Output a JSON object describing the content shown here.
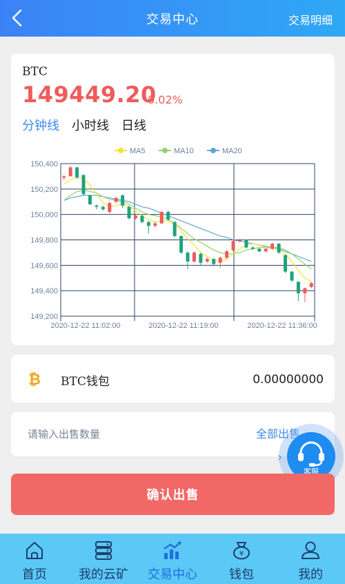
{
  "header": {
    "title": "交易中心",
    "right_link": "交易明细"
  },
  "coin": {
    "name": "BTC",
    "price": "149449.20",
    "change": "0.02%"
  },
  "period_tabs": [
    {
      "label": "分钟线",
      "active": true
    },
    {
      "label": "小时线",
      "active": false
    },
    {
      "label": "日线",
      "active": false
    }
  ],
  "chart_data": {
    "type": "candlestick",
    "legend": [
      "MA5",
      "MA10",
      "MA20"
    ],
    "legend_colors": [
      "#f3e433",
      "#97d16b",
      "#5ea8d0"
    ],
    "y_ticks": [
      "150,400",
      "150,200",
      "150,000",
      "149,800",
      "149,600",
      "149,400",
      "149,200"
    ],
    "ylim": [
      149200,
      150400
    ],
    "x_ticks": [
      "2020-12-22 11:02:00",
      "2020-12-22 11:19:00",
      "2020-12-22 11:36:00"
    ],
    "candles": [
      [
        150290,
        150300,
        150270,
        150310
      ],
      [
        150300,
        150370,
        150300,
        150380
      ],
      [
        150370,
        150290,
        150280,
        150375
      ],
      [
        150310,
        150160,
        150150,
        150315
      ],
      [
        150150,
        150080,
        150075,
        150155
      ],
      [
        150070,
        150060,
        150040,
        150080
      ],
      [
        150060,
        150040,
        150030,
        150070
      ],
      [
        150020,
        150090,
        150010,
        150100
      ],
      [
        150100,
        150130,
        150090,
        150140
      ],
      [
        150150,
        150070,
        150050,
        150160
      ],
      [
        150060,
        149970,
        149960,
        150070
      ],
      [
        149970,
        149990,
        149960,
        150000
      ],
      [
        149990,
        149940,
        149930,
        149995
      ],
      [
        149940,
        149910,
        149850,
        149950
      ],
      [
        149910,
        149930,
        149900,
        149945
      ],
      [
        149930,
        150020,
        149925,
        150030
      ],
      [
        150020,
        149960,
        149950,
        150030
      ],
      [
        149940,
        149830,
        149820,
        149950
      ],
      [
        149830,
        149700,
        149690,
        149835
      ],
      [
        149700,
        149630,
        149570,
        149710
      ],
      [
        149630,
        149700,
        149620,
        149710
      ],
      [
        149690,
        149620,
        149600,
        149700
      ],
      [
        149630,
        149650,
        149620,
        149660
      ],
      [
        149650,
        149610,
        149600,
        149655
      ],
      [
        149620,
        149660,
        149580,
        149670
      ],
      [
        149660,
        149710,
        149650,
        149720
      ],
      [
        149720,
        149790,
        149710,
        149800
      ],
      [
        149790,
        149800,
        149780,
        149810
      ],
      [
        149800,
        149740,
        149735,
        149805
      ],
      [
        149740,
        149730,
        149720,
        149750
      ],
      [
        149730,
        149710,
        149700,
        149735
      ],
      [
        149710,
        149730,
        149700,
        149740
      ],
      [
        149730,
        149770,
        149720,
        149780
      ],
      [
        149770,
        149700,
        149690,
        149775
      ],
      [
        149680,
        149550,
        149540,
        149685
      ],
      [
        149550,
        149480,
        149470,
        149555
      ],
      [
        149470,
        149380,
        149320,
        149475
      ],
      [
        149380,
        149420,
        149310,
        149425
      ],
      [
        149430,
        149460,
        149420,
        149470
      ]
    ],
    "ma5": [
      150240,
      150270,
      150300,
      150280,
      150230,
      150160,
      150090,
      150060,
      150070,
      150080,
      150060,
      150030,
      149990,
      149960,
      149940,
      149950,
      149950,
      149920,
      149870,
      149810,
      149760,
      149700,
      149670,
      149640,
      149630,
      149650,
      149690,
      149730,
      149760,
      149770,
      149760,
      149740,
      149730,
      149730,
      149690,
      149630,
      149560,
      149500,
      149470
    ],
    "ma10": [
      150110,
      150150,
      150180,
      150190,
      150180,
      150170,
      150140,
      150120,
      150110,
      150100,
      150080,
      150050,
      150020,
      150000,
      149990,
      149980,
      149960,
      149930,
      149890,
      149850,
      149810,
      149780,
      149750,
      149720,
      149700,
      149690,
      149690,
      149700,
      149720,
      149730,
      149740,
      149740,
      149740,
      149740,
      149720,
      149690,
      149650,
      149610,
      149570
    ],
    "ma20": [
      150110,
      150130,
      150140,
      150150,
      150150,
      150150,
      150140,
      150130,
      150120,
      150110,
      150100,
      150080,
      150060,
      150050,
      150030,
      150010,
      149990,
      149970,
      149950,
      149930,
      149910,
      149890,
      149870,
      149850,
      149830,
      149820,
      149800,
      149790,
      149780,
      149770,
      149760,
      149750,
      149740,
      149730,
      149710,
      149690,
      149670,
      149650,
      149630
    ]
  },
  "wallet": {
    "label": "BTC钱包",
    "balance": "0.00000000",
    "icon": "bitcoin-icon"
  },
  "sell": {
    "placeholder": "请输入出售数量",
    "all_label": "全部出售"
  },
  "service": {
    "label": "客服"
  },
  "confirm_label": "确认出售",
  "tabs": [
    {
      "label": "首页",
      "icon": "home-icon",
      "active": false
    },
    {
      "label": "我的云矿",
      "icon": "server-icon",
      "active": false
    },
    {
      "label": "交易中心",
      "icon": "trend-chart-icon",
      "active": true
    },
    {
      "label": "钱包",
      "icon": "wallet-icon",
      "active": false
    },
    {
      "label": "我的",
      "icon": "user-icon",
      "active": false
    }
  ],
  "colors": {
    "up": "#ef5b5b",
    "down": "#1fa37a",
    "accent": "#3b8ce8",
    "confirm": "#f26867"
  }
}
